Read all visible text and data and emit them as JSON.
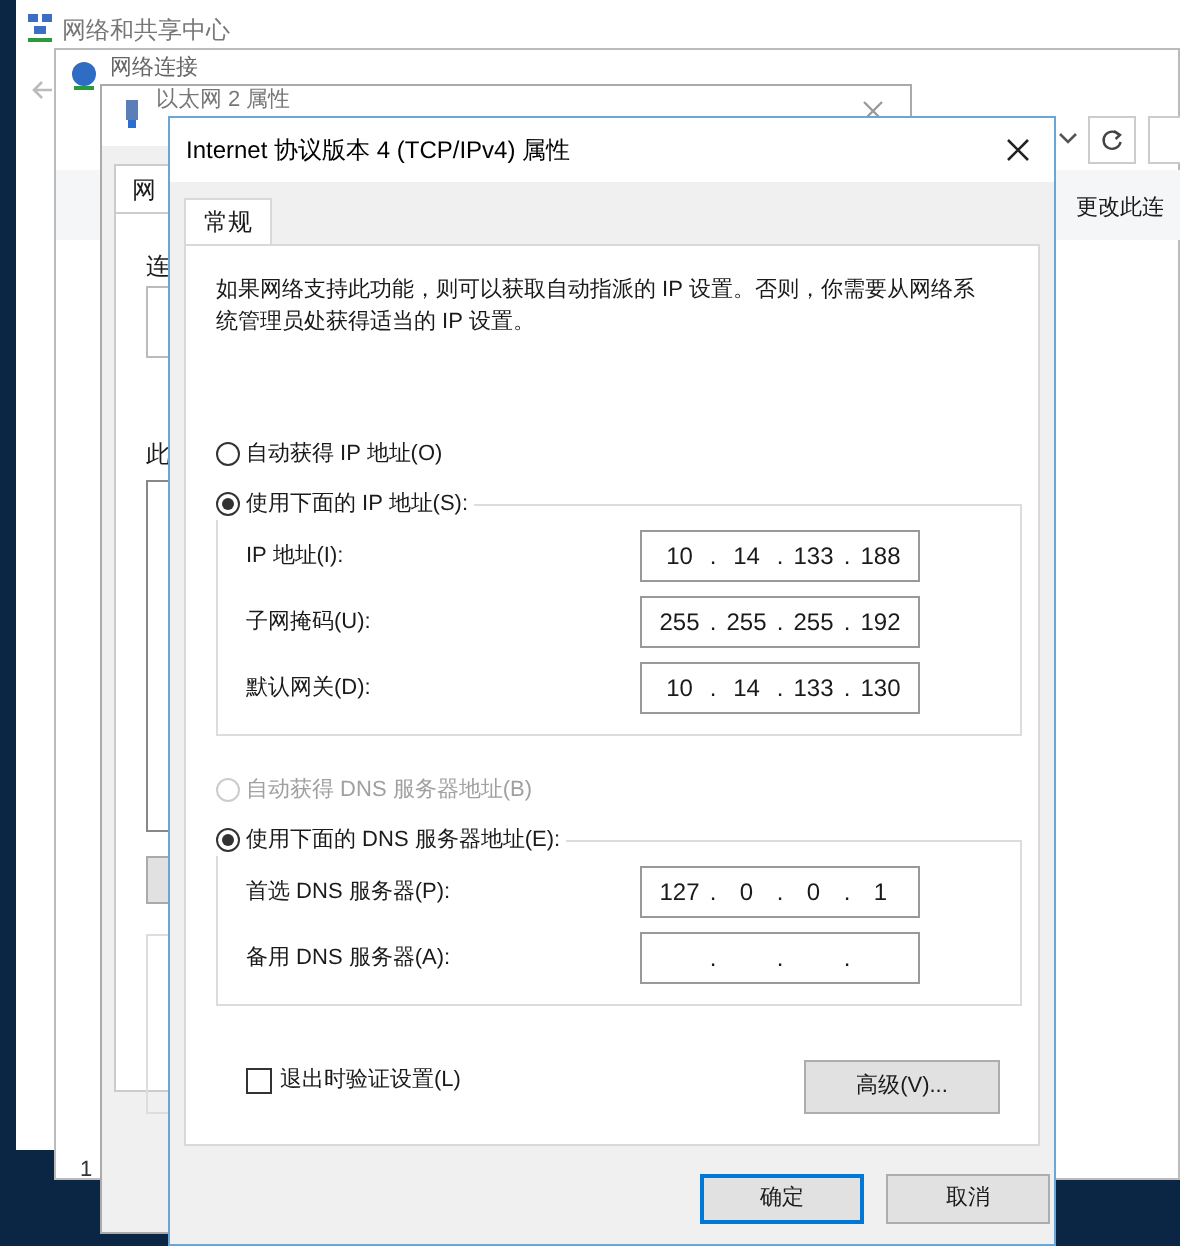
{
  "background_windows": [
    {
      "title": "网络和共享中心"
    },
    {
      "title": "网络连接",
      "link": "更改此连",
      "footer": "1"
    },
    {
      "title": "以太网 2 属性",
      "tab": "网",
      "label_1": "连",
      "label_2": "此"
    }
  ],
  "dialog": {
    "title": "Internet 协议版本 4 (TCP/IPv4) 属性",
    "tabs": [
      {
        "label": "常规",
        "selected": true
      }
    ],
    "description": "如果网络支持此功能，则可以获取自动指派的 IP 设置。否则，你需要从网络系统管理员处获得适当的 IP 设置。",
    "ip_mode": [
      {
        "label": "自动获得 IP 地址(O)",
        "selected": false,
        "disabled": false
      },
      {
        "label": "使用下面的 IP 地址(S):",
        "selected": true,
        "disabled": false
      }
    ],
    "ip_fields": [
      {
        "label": "IP 地址(I):",
        "octets": [
          "10",
          "14",
          "133",
          "188"
        ],
        "separators": [
          ".",
          ".",
          "."
        ]
      },
      {
        "label": "子网掩码(U):",
        "octets": [
          "255",
          "255",
          "255",
          "192"
        ],
        "separators": [
          ".",
          ".",
          "."
        ]
      },
      {
        "label": "默认网关(D):",
        "octets": [
          "10",
          "14",
          "133",
          "130"
        ],
        "separators": [
          ".",
          ".",
          "."
        ]
      }
    ],
    "dns_mode": [
      {
        "label": "自动获得 DNS 服务器地址(B)",
        "selected": false,
        "disabled": true
      },
      {
        "label": "使用下面的 DNS 服务器地址(E):",
        "selected": true,
        "disabled": false
      }
    ],
    "dns_fields": [
      {
        "label": "首选 DNS 服务器(P):",
        "octets": [
          "127",
          "0",
          "0",
          "1"
        ],
        "separators": [
          ".",
          ".",
          "."
        ]
      },
      {
        "label": "备用 DNS 服务器(A):",
        "separators": [
          ".",
          ".",
          "."
        ]
      }
    ],
    "validate_on_exit": {
      "label": "退出时验证设置(L)",
      "checked": false
    },
    "advanced_button": "高级(V)...",
    "buttons": [
      {
        "label": "确定",
        "default": true
      },
      {
        "label": "取消",
        "default": false
      }
    ]
  }
}
